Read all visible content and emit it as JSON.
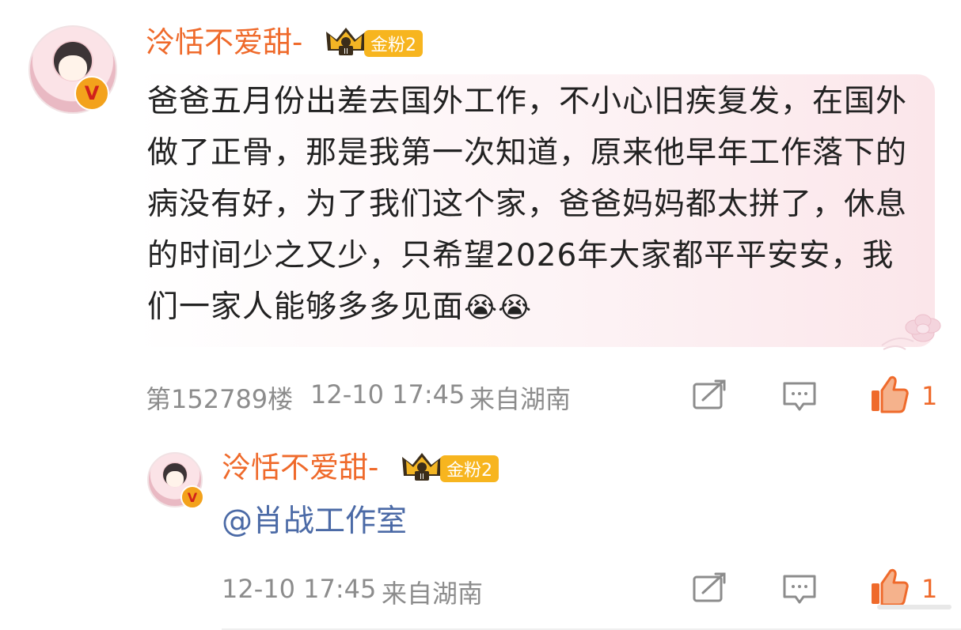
{
  "comment": {
    "username": "泠恬不爱甜-",
    "fan_badge": "金粉2",
    "text": "爸爸五月份出差去国外工作，不小心旧疾复发，在国外做了正骨，那是我第一次知道，原来他早年工作落下的病没有好，为了我们这个家，爸爸妈妈都太拼了，休息的时间少之又少，只希望2026年大家都平平安安，我们一家人能够多多见面",
    "emoji": "😭😭",
    "floor": "第152789楼",
    "time": "12-10 17:45",
    "location": "来自湖南",
    "like_count": "1"
  },
  "reply": {
    "username": "泠恬不爱甜-",
    "fan_badge": "金粉2",
    "mention": "@肖战工作室",
    "time": "12-10 17:45",
    "location": "来自湖南",
    "like_count": "1"
  },
  "icons": {
    "verified": "verified-badge-icon",
    "crown": "crown-icon",
    "repost": "repost-icon",
    "comment": "comment-icon",
    "like": "like-icon",
    "flower": "flower-decoration-icon"
  },
  "colors": {
    "username": "#ef6a2b",
    "badge": "#f7b51f",
    "mention": "#4b6aa6",
    "meta": "#8c8c8c"
  }
}
